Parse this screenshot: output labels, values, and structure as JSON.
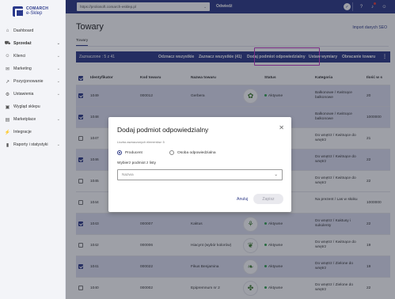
{
  "brand": {
    "line1": "COMARCH",
    "line2": "e-Sklep"
  },
  "topbar": {
    "url": "https://proliosoft.comarch-esklep.pl",
    "logout_label": "Odwiedź"
  },
  "sidebar": {
    "items": [
      {
        "label": "Dashboard",
        "icon": "home-icon",
        "chevron": false
      },
      {
        "label": "Sprzedaż",
        "icon": "cart-icon",
        "chevron": true,
        "active": true
      },
      {
        "label": "Klienci",
        "icon": "users-icon",
        "chevron": true
      },
      {
        "label": "Marketing",
        "icon": "megaphone-icon",
        "chevron": true
      },
      {
        "label": "Pozycjonowanie",
        "icon": "chart-icon",
        "chevron": true
      },
      {
        "label": "Ustawienia",
        "icon": "gear-icon",
        "chevron": true
      },
      {
        "label": "Wygląd sklepu",
        "icon": "palette-icon",
        "chevron": false
      },
      {
        "label": "Marketplace",
        "icon": "store-icon",
        "chevron": true
      },
      {
        "label": "Integracje",
        "icon": "plug-icon",
        "chevron": false
      },
      {
        "label": "Raporty i statystyki",
        "icon": "bar-chart-icon",
        "chevron": true
      }
    ]
  },
  "page": {
    "title": "Towary",
    "import_link": "Import danych SEO",
    "tab": "Towary"
  },
  "actionbar": {
    "selected": "Zaznaczone : 5 z 41",
    "unselect_all": "Odznacz wszystkie",
    "select_all": "Zaznacz wszystkie (41)",
    "assign_responsible": "Dodaj podmiot odpowiedzialny",
    "set_size": "Ustaw wymiary",
    "rotate_image": "Obracanie towaru",
    "more": "⋮"
  },
  "table": {
    "headers": {
      "id": "Identyfikator",
      "code": "Kod towaru",
      "name": "Nazwa towaru",
      "status": "Status",
      "category": "Kategoria",
      "qty": "Ilość w s"
    },
    "rows": [
      {
        "selected": true,
        "id": "1049",
        "code": "000012",
        "name": "Gerbera",
        "status": "Aktywne",
        "category": "Balkonowe / Kwitnące balkonowe",
        "qty": "20"
      },
      {
        "selected": true,
        "id": "1048",
        "code": "",
        "name": "",
        "status": "",
        "category": "Balkonowe / Kwitnące balkonowe",
        "qty": "1000000"
      },
      {
        "selected": false,
        "id": "1047",
        "code": "",
        "name": "",
        "status": "",
        "category": "Do wnętrz / Kwitnące do wnętrz",
        "qty": "21"
      },
      {
        "selected": true,
        "id": "1046",
        "code": "",
        "name": "",
        "status": "",
        "category": "Do wnętrz / Kwitnące do wnętrz",
        "qty": "22"
      },
      {
        "selected": false,
        "id": "1045",
        "code": "",
        "name": "",
        "status": "",
        "category": "Do wnętrz / Kwitnące do wnętrz",
        "qty": "22"
      },
      {
        "selected": false,
        "id": "1044",
        "code": "",
        "name": "",
        "status": "",
        "category": "Na prezent / Las w słoiku",
        "qty": "1000000"
      },
      {
        "selected": true,
        "id": "1043",
        "code": "000007",
        "name": "Kaktus",
        "status": "Aktywne",
        "category": "Do wnętrz / Kaktusy i sukulenty",
        "qty": "22"
      },
      {
        "selected": false,
        "id": "1042",
        "code": "000006",
        "name": "Hiacynt (wybór kolorów)",
        "status": "Aktywne",
        "category": "Do wnętrz / Kwitnące do wnętrz",
        "qty": "19"
      },
      {
        "selected": true,
        "id": "1041",
        "code": "000022",
        "name": "Fikus Benjamina",
        "status": "Aktywne",
        "category": "Do wnętrz / Zielone do wnętrz",
        "qty": "19"
      },
      {
        "selected": false,
        "id": "1040",
        "code": "000002",
        "name": "Epipremnum nr 2",
        "status": "Aktywne",
        "category": "Do wnętrz / Zielone do wnętrz",
        "qty": "22"
      }
    ]
  },
  "dialog": {
    "title": "Dodaj podmiot odpowiedzialny",
    "count_text": "Liczba zaznaczonych elementów: 5",
    "option_producer": "Producent",
    "option_person": "Osoba odpowiedzialna",
    "select_label": "Wybierz podmiot z listy",
    "select_placeholder": "Nazwa",
    "cancel_label": "Anuluj",
    "save_label": "Zapisz"
  },
  "colors": {
    "primary": "#2e3a87",
    "highlight": "#c33bc7",
    "status_active": "#2fa24d"
  }
}
